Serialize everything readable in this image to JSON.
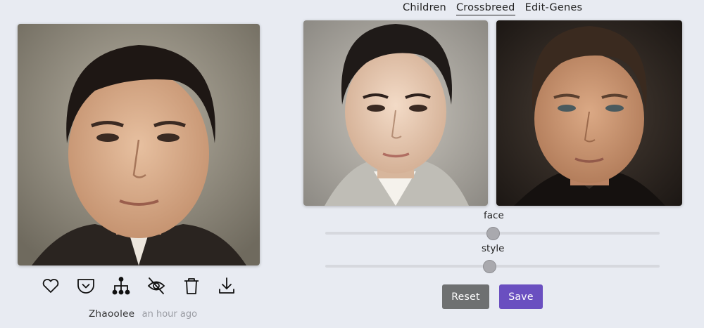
{
  "tabs": [
    {
      "label": "Children",
      "active": false
    },
    {
      "label": "Crossbreed",
      "active": true
    },
    {
      "label": "Edit-Genes",
      "active": false
    }
  ],
  "main_photo": {
    "author": "Zhaoolee",
    "time": "an hour ago",
    "actions": [
      "heart-icon",
      "pocket-icon",
      "family-tree-icon",
      "eye-off-icon",
      "trash-icon",
      "download-icon"
    ]
  },
  "sliders": [
    {
      "label": "face",
      "value": 0.5
    },
    {
      "label": "style",
      "value": 0.49
    }
  ],
  "buttons": {
    "reset_label": "Reset",
    "save_label": "Save"
  },
  "colors": {
    "reset_bg": "#6e7071",
    "save_bg": "#6a4fc0",
    "background": "#e8ebf2"
  }
}
